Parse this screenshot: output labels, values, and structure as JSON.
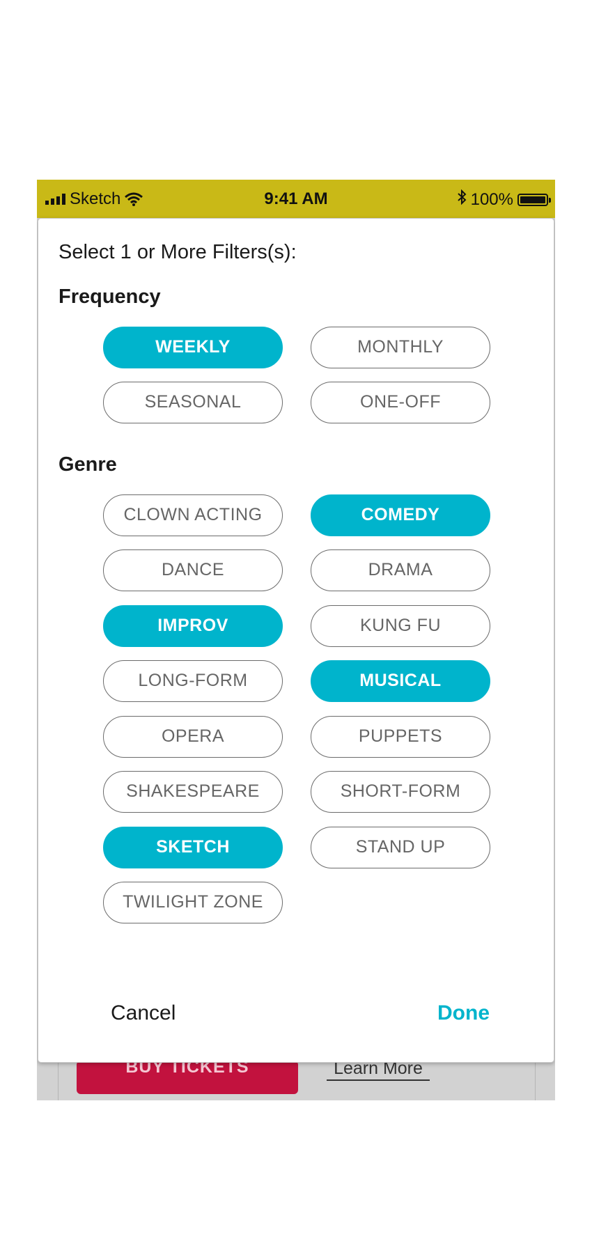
{
  "status_bar": {
    "carrier": "Sketch",
    "time": "9:41 AM",
    "battery": "100%"
  },
  "background": {
    "buy_tickets_label": "BUY TICKETS",
    "learn_more_label": "Learn More"
  },
  "modal": {
    "title": "Select 1 or More Filters(s):",
    "frequency": {
      "heading": "Frequency",
      "options": [
        {
          "label": "WEEKLY",
          "selected": true
        },
        {
          "label": "MONTHLY",
          "selected": false
        },
        {
          "label": "SEASONAL",
          "selected": false
        },
        {
          "label": "ONE-OFF",
          "selected": false
        }
      ]
    },
    "genre": {
      "heading": "Genre",
      "options": [
        {
          "label": "CLOWN ACTING",
          "selected": false
        },
        {
          "label": "COMEDY",
          "selected": true
        },
        {
          "label": "DANCE",
          "selected": false
        },
        {
          "label": "DRAMA",
          "selected": false
        },
        {
          "label": "IMPROV",
          "selected": true
        },
        {
          "label": "KUNG FU",
          "selected": false
        },
        {
          "label": "LONG-FORM",
          "selected": false
        },
        {
          "label": "MUSICAL",
          "selected": true
        },
        {
          "label": "OPERA",
          "selected": false
        },
        {
          "label": "PUPPETS",
          "selected": false
        },
        {
          "label": "SHAKESPEARE",
          "selected": false
        },
        {
          "label": "SHORT-FORM",
          "selected": false
        },
        {
          "label": "SKETCH",
          "selected": true
        },
        {
          "label": "STAND UP",
          "selected": false
        },
        {
          "label": "TWILIGHT ZONE",
          "selected": false
        }
      ]
    },
    "cancel_label": "Cancel",
    "done_label": "Done"
  },
  "colors": {
    "status_bar": "#c9b917",
    "accent": "#00b4cc",
    "buy_button": "#c2123e"
  },
  "icons": [
    "signal-icon",
    "wifi-icon",
    "bluetooth-icon",
    "battery-icon"
  ]
}
